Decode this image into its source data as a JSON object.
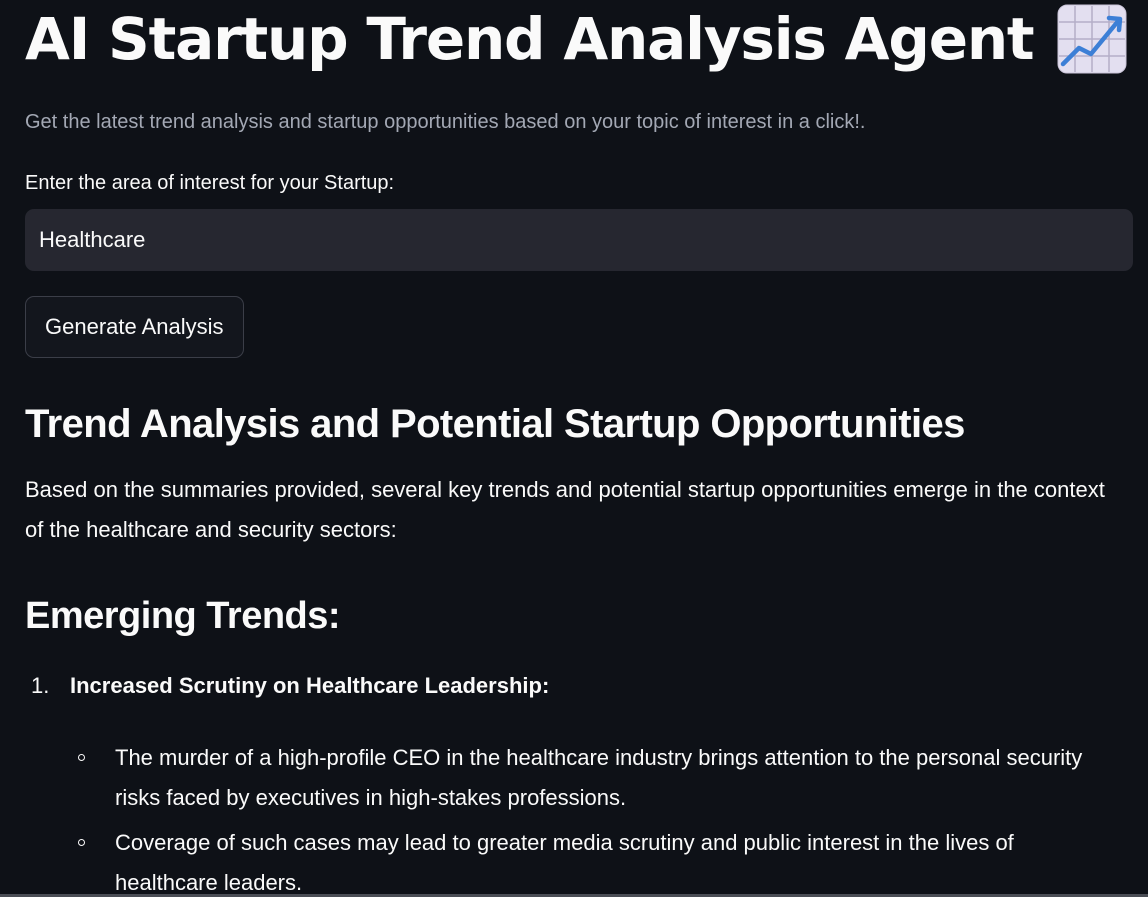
{
  "header": {
    "title": "AI Startup Trend Analysis Agent",
    "title_emoji_icon": "chart-increasing-icon",
    "subtitle": "Get the latest trend analysis and startup opportunities based on your topic of interest in a click!."
  },
  "form": {
    "input_label": "Enter the area of interest for your Startup:",
    "input_value": "Healthcare",
    "button_label": "Generate Analysis"
  },
  "result": {
    "heading": "Trend Analysis and Potential Startup Opportunities",
    "intro": "Based on the summaries provided, several key trends and potential startup opportunities emerge in the context of the healthcare and security sectors:",
    "trends_heading": "Emerging Trends:",
    "trends": [
      {
        "number": "1.",
        "title": "Increased Scrutiny on Healthcare Leadership:",
        "bullets": [
          "The murder of a high-profile CEO in the healthcare industry brings attention to the personal security risks faced by executives in high-stakes professions.",
          "Coverage of such cases may lead to greater media scrutiny and public interest in the lives of healthcare leaders."
        ]
      }
    ]
  },
  "colors": {
    "background": "#0e1117",
    "text": "#fafafa",
    "muted_text": "#a3a8b4",
    "input_background": "#262730",
    "button_border": "#3b3e48"
  }
}
